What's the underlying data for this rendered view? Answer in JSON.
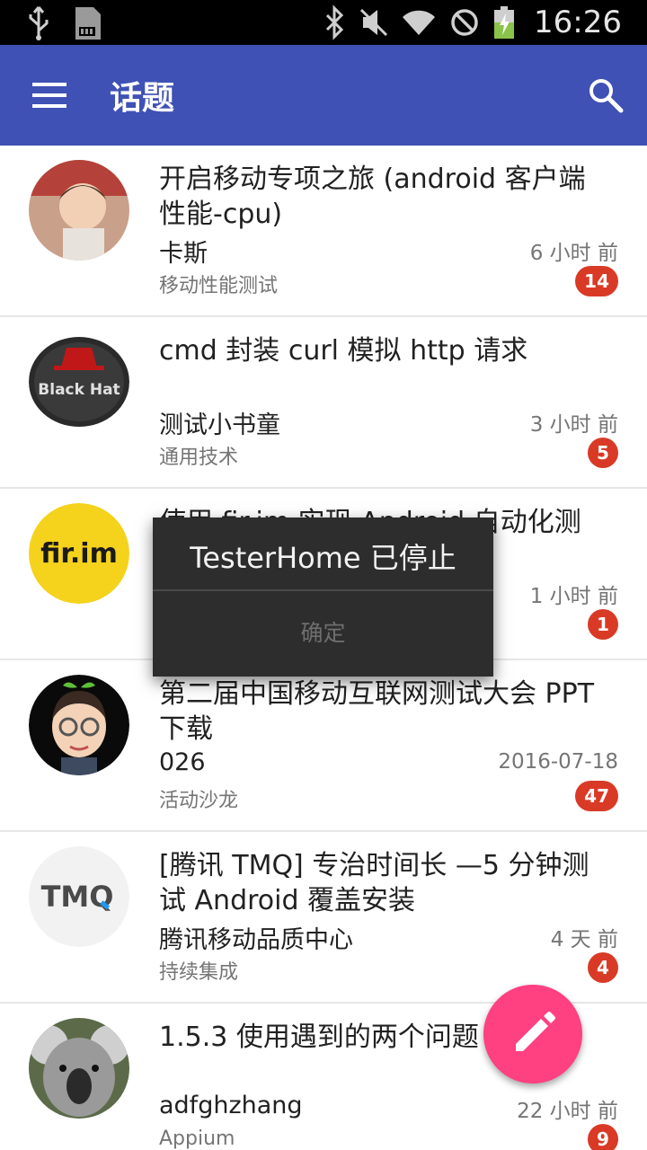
{
  "status_bar": {
    "time": "16:26",
    "icons": [
      "usb-icon",
      "sd-card-icon",
      "bluetooth-icon",
      "mute-icon",
      "wifi-icon",
      "no-signal-icon",
      "battery-charging-icon"
    ]
  },
  "app_bar": {
    "title": "话题",
    "menu_icon": "menu-icon",
    "search_icon": "search-icon",
    "color": "#3f51b5"
  },
  "topics": [
    {
      "title": "开启移动专项之旅 (android 客户端性能-cpu)",
      "author": "卡斯",
      "time": "6 小时 前",
      "node": "移动性能测试",
      "replies": "14"
    },
    {
      "title": "cmd 封装 curl 模拟 http 请求",
      "author": "测试小书童",
      "time": "3 小时 前",
      "node": "通用技术",
      "replies": "5"
    },
    {
      "title": "使用 fir.im 实现 Android 自动化测",
      "author": "",
      "time": "1 小时 前",
      "node": "",
      "replies": "1",
      "avatar_text": "fir.im"
    },
    {
      "title": "第二届中国移动互联网测试大会 PPT 下载",
      "author": "026",
      "time": "2016-07-18",
      "node": "活动沙龙",
      "replies": "47"
    },
    {
      "title": "[腾讯 TMQ] 专治时间长 —5 分钟测试 Android 覆盖安装",
      "author": "腾讯移动品质中心",
      "time": "4 天 前",
      "node": "持续集成",
      "replies": "4",
      "avatar_text": "TMQ"
    },
    {
      "title": "1.5.3 使用遇到的两个问题",
      "author": "adfghzhang",
      "time": "22 小时 前",
      "node": "Appium",
      "replies": "9"
    }
  ],
  "avatars": {
    "black_hat_text": "Black Hat"
  },
  "fab": {
    "icon": "pencil-icon",
    "color": "#ff4081"
  },
  "dialog": {
    "message": "TesterHome 已停止",
    "ok_label": "确定"
  },
  "colors": {
    "badge": "#d93a26",
    "secondary_text": "#757575"
  }
}
